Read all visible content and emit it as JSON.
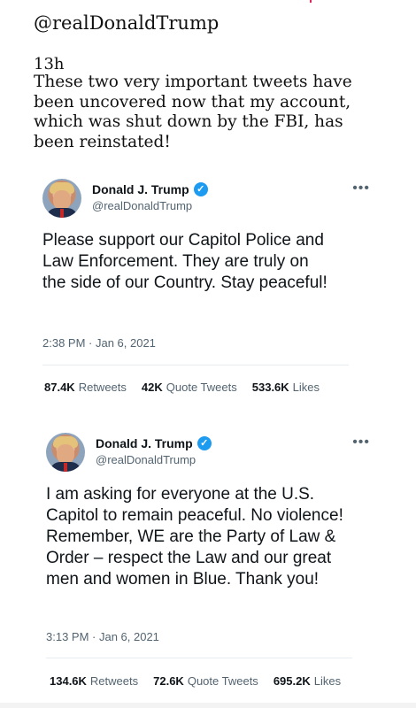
{
  "post": {
    "header": "@realDonaldTrump",
    "time": "13h",
    "text": "These two very important tweets have been uncovered now that my account, which was shut down by the FBI, has been reinstated!"
  },
  "tweets": [
    {
      "name": "Donald J. Trump",
      "handle": "@realDonaldTrump",
      "body": "Please support our Capitol Police and Law Enforcement. They are truly on the side of our Country. Stay peaceful!",
      "timestamp": "2:38 PM · Jan 6, 2021",
      "retweets_count": "87.4K",
      "retweets_label": "Retweets",
      "quotes_count": "42K",
      "quotes_label": "Quote Tweets",
      "likes_count": "533.6K",
      "likes_label": "Likes"
    },
    {
      "name": "Donald J. Trump",
      "handle": "@realDonaldTrump",
      "body": "I am asking for everyone at the U.S. Capitol to remain peaceful. No violence! Remember, WE are the Party of Law & Order – respect the Law and our great men and women in Blue. Thank you!",
      "timestamp": "3:13 PM · Jan 6, 2021",
      "retweets_count": "134.6K",
      "retweets_label": "Retweets",
      "quotes_count": "72.6K",
      "quotes_label": "Quote Tweets",
      "likes_count": "695.2K",
      "likes_label": "Likes"
    }
  ],
  "icons": {
    "verified": "verified-badge-icon",
    "more": "more-options-icon",
    "verified_color": "#1d9bf0"
  }
}
